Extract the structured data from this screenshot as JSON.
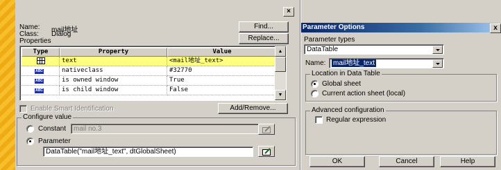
{
  "left_dialog": {
    "name_label": "Name:",
    "name_value": "mail地址",
    "class_label": "Class:",
    "class_value": "Dialog",
    "properties_label": "Properties",
    "find_button": "Find...",
    "replace_button": "Replace...",
    "grid": {
      "headers": [
        "Type",
        "Property",
        "Value"
      ],
      "rows": [
        {
          "icon": "table-icon",
          "property": "text",
          "value": "<mail地址_text>",
          "selected": true
        },
        {
          "icon": "abc-icon",
          "property": "nativeclass",
          "value": "#32770",
          "selected": false
        },
        {
          "icon": "abc-icon",
          "property": "is owned window",
          "value": "True",
          "selected": false
        },
        {
          "icon": "abc-icon",
          "property": "is child window",
          "value": "False",
          "selected": false
        }
      ]
    },
    "smart_id_label": "Enable Smart Identification",
    "add_remove_button": "Add/Remove...",
    "configure_value_title": "Configure value",
    "constant_label": "Constant",
    "constant_value": "mail no.3",
    "parameter_label": "Parameter",
    "parameter_value": "DataTable(\"mail地址_text\", dtGlobalSheet)"
  },
  "right_dialog": {
    "title": "Parameter Options",
    "close": "x",
    "parameter_types_label": "Parameter types",
    "parameter_type_value": "DataTable",
    "name_label": "Name:",
    "name_value": "mail地址_text",
    "location_title": "Location in Data Table",
    "global_sheet_label": "Global sheet",
    "current_sheet_label": "Current action sheet (local)",
    "advanced_title": "Advanced configuration",
    "regex_label": "Regular expression",
    "ok_button": "OK",
    "cancel_button": "Cancel",
    "help_button": "Help"
  },
  "colors": {
    "background": "#f3b21a",
    "dialog": "#d4d0c8",
    "titlebar": "#0a246a",
    "selected_row": "#ffff80"
  }
}
